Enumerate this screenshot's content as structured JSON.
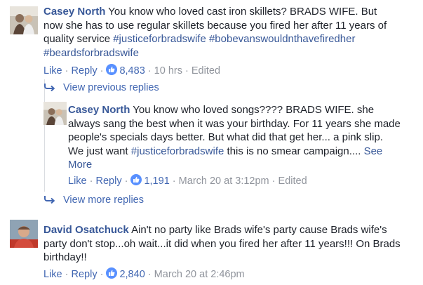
{
  "comments": [
    {
      "author": "Casey North",
      "text_before": "You know who loved cast iron skillets? BRADS WIFE. But now she has to use regular skillets because you fired her after 11 years of quality service ",
      "hashtags": [
        "#justiceforbradswife",
        "#bobevanswouldnthavefiredher",
        "#beardsforbradswife"
      ],
      "actions": {
        "like": "Like",
        "reply": "Reply",
        "reaction_count": "8,483",
        "time": "10 hrs",
        "edited": "Edited"
      }
    },
    {
      "view_previous_replies": "View previous replies",
      "author": "Casey North",
      "text_before": "You know who loved songs???? BRADS WIFE. she always sang the best when it was your birthday. For 11 years she made people's specials days better. But what did that get her... a pink slip. We just want ",
      "hashtag": "#justiceforbradswife",
      "text_after": " this is no smear campaign.... ",
      "see_more": "See More",
      "actions": {
        "like": "Like",
        "reply": "Reply",
        "reaction_count": "1,191",
        "time": "March 20 at 3:12pm",
        "edited": "Edited"
      },
      "view_more_replies": "View more replies"
    },
    {
      "author": "David Osatchuck",
      "text": "Ain't no party like Brads wife's party cause Brads wife's party don't stop...oh wait...it did when you fired her after 11 years!!! On Brads birthday!!",
      "actions": {
        "like": "Like",
        "reply": "Reply",
        "reaction_count": "2,840",
        "time": "March 20 at 2:46pm"
      }
    }
  ],
  "colors": {
    "link": "#385898",
    "action": "#4267b2",
    "meta": "#90949c",
    "text": "#1d2129",
    "like_badge": "#5890ff"
  },
  "separator": "·"
}
